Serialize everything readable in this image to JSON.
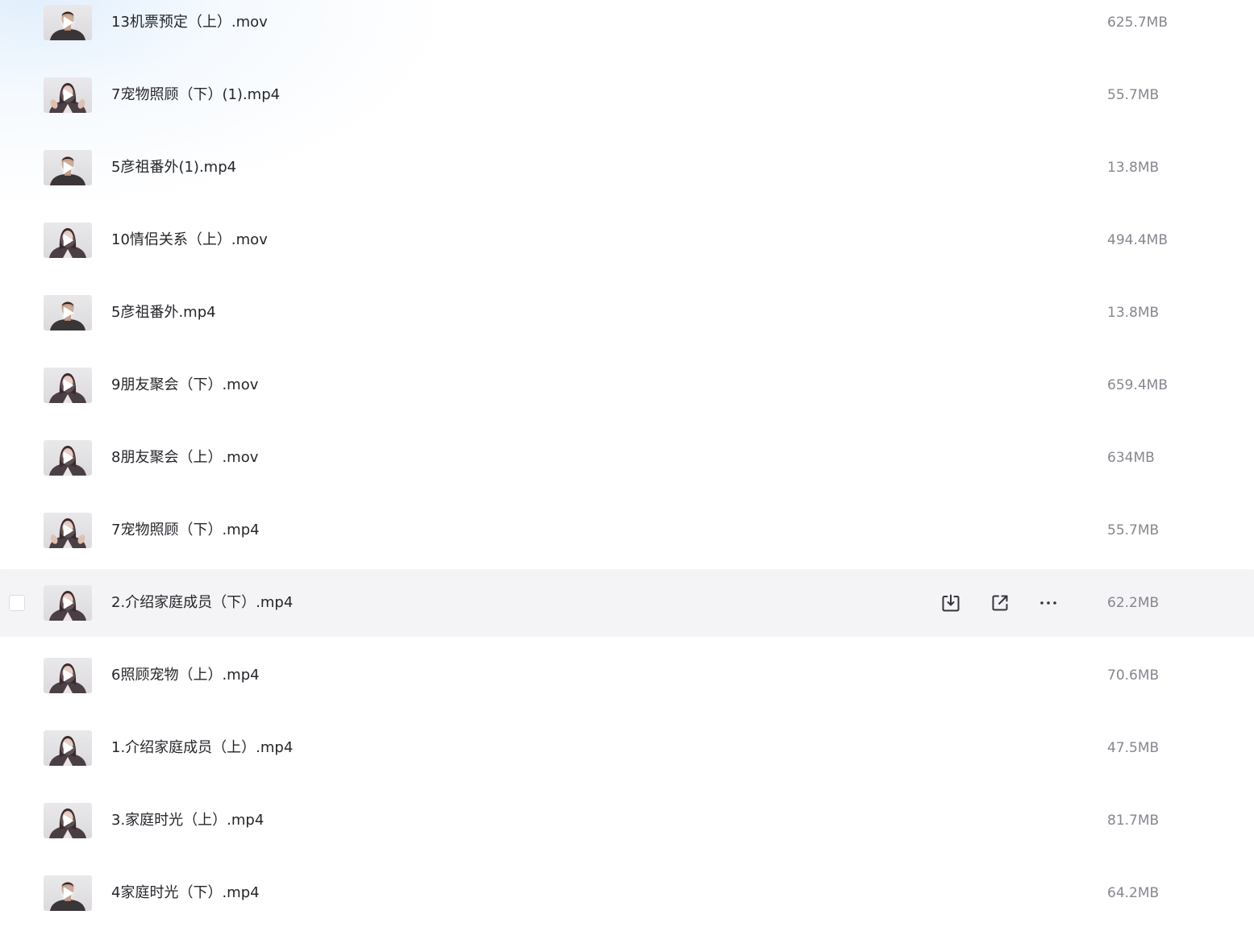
{
  "files": [
    {
      "name": "13机票预定（上）.mov",
      "size": "625.7MB",
      "thumb": "man"
    },
    {
      "name": "7宠物照顾（下）(1).mp4",
      "size": "55.7MB",
      "thumb": "woman-hands"
    },
    {
      "name": "5彦祖番外(1).mp4",
      "size": "13.8MB",
      "thumb": "man"
    },
    {
      "name": "10情侣关系（上）.mov",
      "size": "494.4MB",
      "thumb": "woman"
    },
    {
      "name": "5彦祖番外.mp4",
      "size": "13.8MB",
      "thumb": "man"
    },
    {
      "name": "9朋友聚会（下）.mov",
      "size": "659.4MB",
      "thumb": "woman"
    },
    {
      "name": "8朋友聚会（上）.mov",
      "size": "634MB",
      "thumb": "woman"
    },
    {
      "name": "7宠物照顾（下）.mp4",
      "size": "55.7MB",
      "thumb": "woman-hands"
    },
    {
      "name": "2.介绍家庭成员（下）.mp4",
      "size": "62.2MB",
      "thumb": "woman",
      "hovered": true
    },
    {
      "name": "6照顾宠物（上）.mp4",
      "size": "70.6MB",
      "thumb": "woman"
    },
    {
      "name": "1.介绍家庭成员（上）.mp4",
      "size": "47.5MB",
      "thumb": "woman"
    },
    {
      "name": "3.家庭时光（上）.mp4",
      "size": "81.7MB",
      "thumb": "woman"
    },
    {
      "name": "4家庭时光（下）.mp4",
      "size": "64.2MB",
      "thumb": "man-smile"
    }
  ],
  "row_actions": {
    "download_icon": "download-icon",
    "share_icon": "share-icon",
    "more_icon": "more-icon"
  },
  "colors": {
    "text": "#25262b",
    "size_text": "#85878f",
    "hover_bg": "#f4f4f6",
    "icon": "#33353c"
  }
}
